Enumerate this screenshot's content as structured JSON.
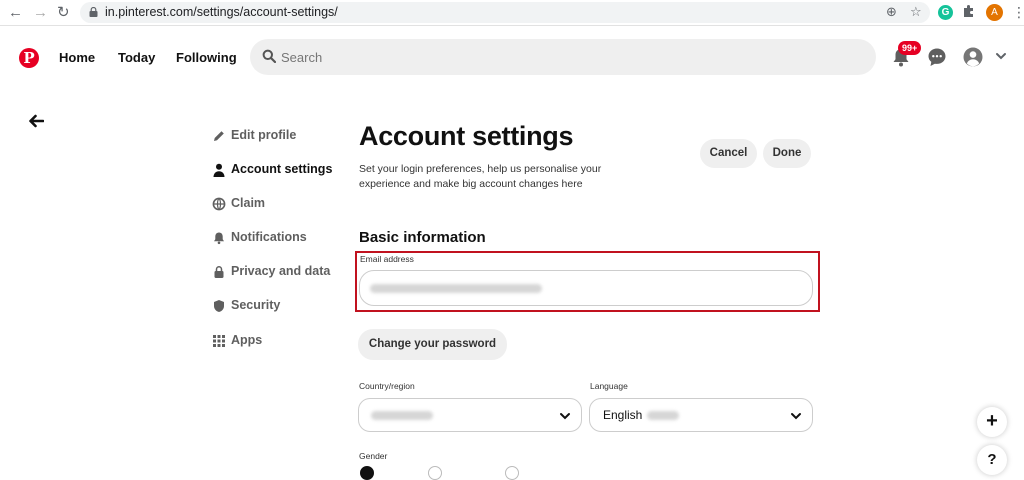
{
  "browser": {
    "url": "in.pinterest.com/settings/account-settings/",
    "profile_initial": "A",
    "extension_initial": "G"
  },
  "header": {
    "logo": "P",
    "nav": [
      "Home",
      "Today",
      "Following"
    ],
    "search_placeholder": "Search",
    "notifications_badge": "99+"
  },
  "sidebar": {
    "items": [
      {
        "label": "Edit profile",
        "icon": "pencil-icon"
      },
      {
        "label": "Account settings",
        "icon": "person-icon",
        "active": true
      },
      {
        "label": "Claim",
        "icon": "globe-icon"
      },
      {
        "label": "Notifications",
        "icon": "bell-icon"
      },
      {
        "label": "Privacy and data",
        "icon": "lock-icon"
      },
      {
        "label": "Security",
        "icon": "shield-icon"
      },
      {
        "label": "Apps",
        "icon": "grid-icon"
      }
    ]
  },
  "main": {
    "title": "Account settings",
    "subtitle": "Set your login preferences, help us personalise your experience and make big account changes here",
    "cancel_label": "Cancel",
    "done_label": "Done",
    "basic_info_heading": "Basic information",
    "email_label": "Email address",
    "change_password_label": "Change your password",
    "country_label": "Country/region",
    "language_label": "Language",
    "language_value": "English",
    "gender_label": "Gender"
  },
  "colors": {
    "brand": "#e60023",
    "highlight_box": "#c1121f",
    "pill_bg": "#efefef"
  }
}
